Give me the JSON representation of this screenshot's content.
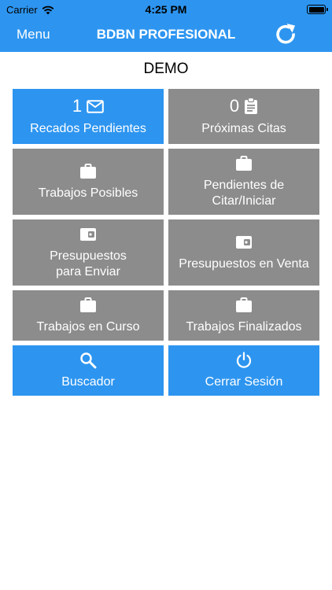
{
  "status_bar": {
    "carrier": "Carrier",
    "time": "4:25 PM"
  },
  "nav": {
    "menu_label": "Menu",
    "title": "BDBN PROFESIONAL",
    "refresh_icon": "refresh-icon"
  },
  "subtitle": "DEMO",
  "colors": {
    "accent": "#2d95f0",
    "tile_gray": "#8c8c8c"
  },
  "tiles": [
    {
      "count": "1",
      "icon": "mail-icon",
      "label": "Recados Pendientes"
    },
    {
      "count": "0",
      "icon": "clipboard-icon",
      "label": "Próximas Citas"
    },
    {
      "icon": "briefcase-icon",
      "label": "Trabajos Posibles"
    },
    {
      "icon": "briefcase-icon",
      "label": "Pendientes de\nCitar/Iniciar"
    },
    {
      "icon": "wallet-icon",
      "label": "Presupuestos\npara Enviar"
    },
    {
      "icon": "wallet-icon",
      "label": "Presupuestos en Venta"
    },
    {
      "icon": "briefcase-icon",
      "label": "Trabajos en Curso"
    },
    {
      "icon": "briefcase-icon",
      "label": "Trabajos Finalizados"
    },
    {
      "icon": "search-icon",
      "label": "Buscador"
    },
    {
      "icon": "power-icon",
      "label": "Cerrar Sesión"
    }
  ]
}
